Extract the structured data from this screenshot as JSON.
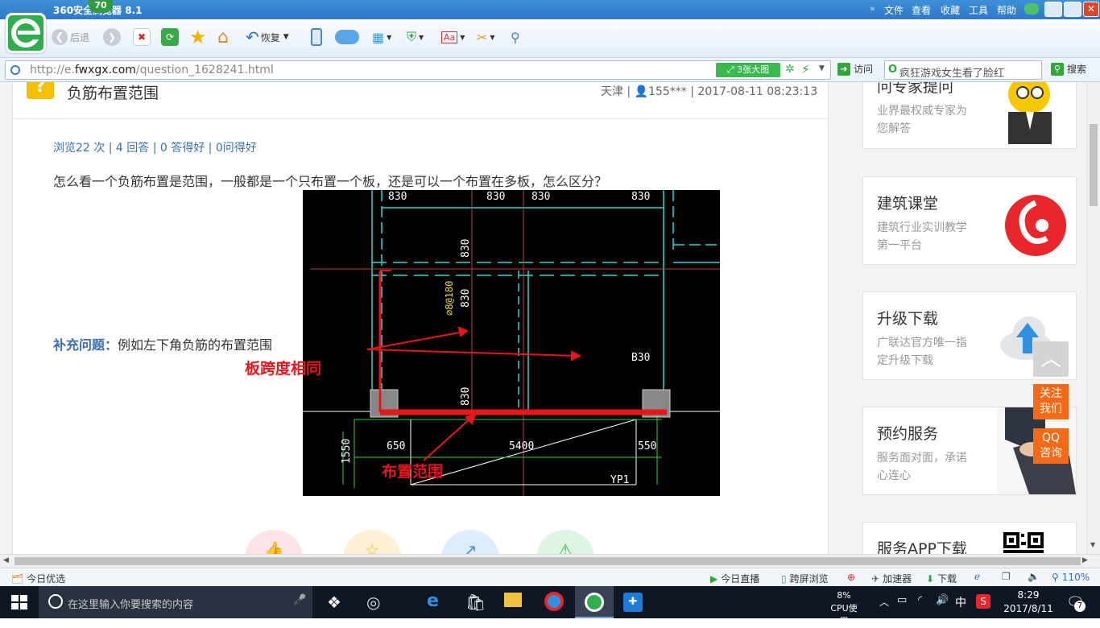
{
  "browser": {
    "title": "360安全浏览器 8.1",
    "score_badge": "70",
    "menu": [
      "文件",
      "查看",
      "收藏",
      "工具",
      "帮助"
    ],
    "back_label": "后退",
    "restore_label": "恢复",
    "url_prefix": "http://e.",
    "url_domain": "fwxgx.com",
    "url_path": "/question_1628241.html",
    "bigimage_label": "3张大图",
    "visit_label": "访问",
    "search_placeholder": "疯狂游戏女生看了脸红",
    "search_label": "搜索"
  },
  "question": {
    "title": "负筋布置范围",
    "meta_prefix": "天津 |",
    "meta_user": "155***",
    "meta_time": "| 2017-08-11 08:23:13",
    "stats": "浏览22 次 | 4 回答 | 0 答得好 | 0问得好",
    "body": "怎么看一个负筋布置是范围，一般都是一个只布置一个板，还是可以一个布置在多板，怎么区分？",
    "supp_label": "补充问题：",
    "supp_text": "例如左下角负筋的布置范围"
  },
  "drawing": {
    "dims_top": [
      "830",
      "830",
      "830",
      "830"
    ],
    "dims_vert": [
      "830",
      "830",
      "830"
    ],
    "rebar_label": "⌀8@180",
    "b_label": "B30",
    "bottom_dims": [
      "650",
      "5400",
      "550"
    ],
    "left_dim": "1550",
    "beam_label": "YP1",
    "annot_span": "板跨度相同",
    "annot_range": "布置范围"
  },
  "sidebar": {
    "cards": [
      {
        "title": "问专家提问",
        "desc": "业界最权威专家为您解答"
      },
      {
        "title": "建筑课堂",
        "desc": "建筑行业实训教学第一平台"
      },
      {
        "title": "升级下载",
        "desc": "广联达官方唯一指定升级下载"
      },
      {
        "title": "预约服务",
        "desc": "服务面对面，承诺心连心"
      },
      {
        "title": "服务APP下载",
        "desc": ""
      }
    ],
    "follow_label": "关注我们",
    "qq_label": "QQ咨询"
  },
  "status": {
    "left": "今日优选",
    "live": "今日直播",
    "cross": "跨屏浏览",
    "accelerator": "加速器",
    "download": "下载",
    "zoom": "110%"
  },
  "taskbar": {
    "search_placeholder": "在这里输入你要搜索的内容",
    "cpu_percent": "8%",
    "cpu_label": "CPU使用",
    "ime": "中",
    "time": "8:29",
    "date": "2017/8/11",
    "notification_count": "7"
  }
}
